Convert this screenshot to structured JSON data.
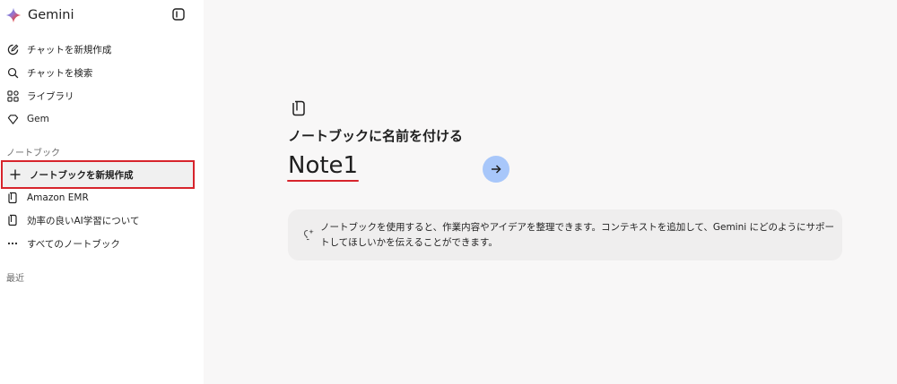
{
  "app": {
    "name": "Gemini"
  },
  "sidebar": {
    "items": [
      {
        "label": "チャットを新規作成",
        "icon": "edit-icon"
      },
      {
        "label": "チャットを検索",
        "icon": "search-icon"
      },
      {
        "label": "ライブラリ",
        "icon": "library-icon"
      },
      {
        "label": "Gem",
        "icon": "gem-icon"
      }
    ],
    "notebook_section": {
      "title": "ノートブック",
      "new_label": "ノートブックを新規作成",
      "items": [
        {
          "label": "Amazon EMR",
          "icon": "notebook-icon"
        },
        {
          "label": "効率の良いAI学習について",
          "icon": "notebook-icon"
        },
        {
          "label": "すべてのノートブック",
          "icon": "more-icon"
        }
      ]
    },
    "recent_title": "最近"
  },
  "main": {
    "heading": "ノートブックに名前を付ける",
    "name_value": "Note1",
    "info_text": "ノートブックを使用すると、作業内容やアイデアを整理できます。コンテキストを追加して、Gemini にどのようにサポートしてほしいかを伝えることができます。"
  },
  "colors": {
    "highlight_red": "#d7242c",
    "submit_button": "#a8c7fa",
    "main_bg": "#f8f7f7",
    "info_box_bg": "#efeeee"
  }
}
